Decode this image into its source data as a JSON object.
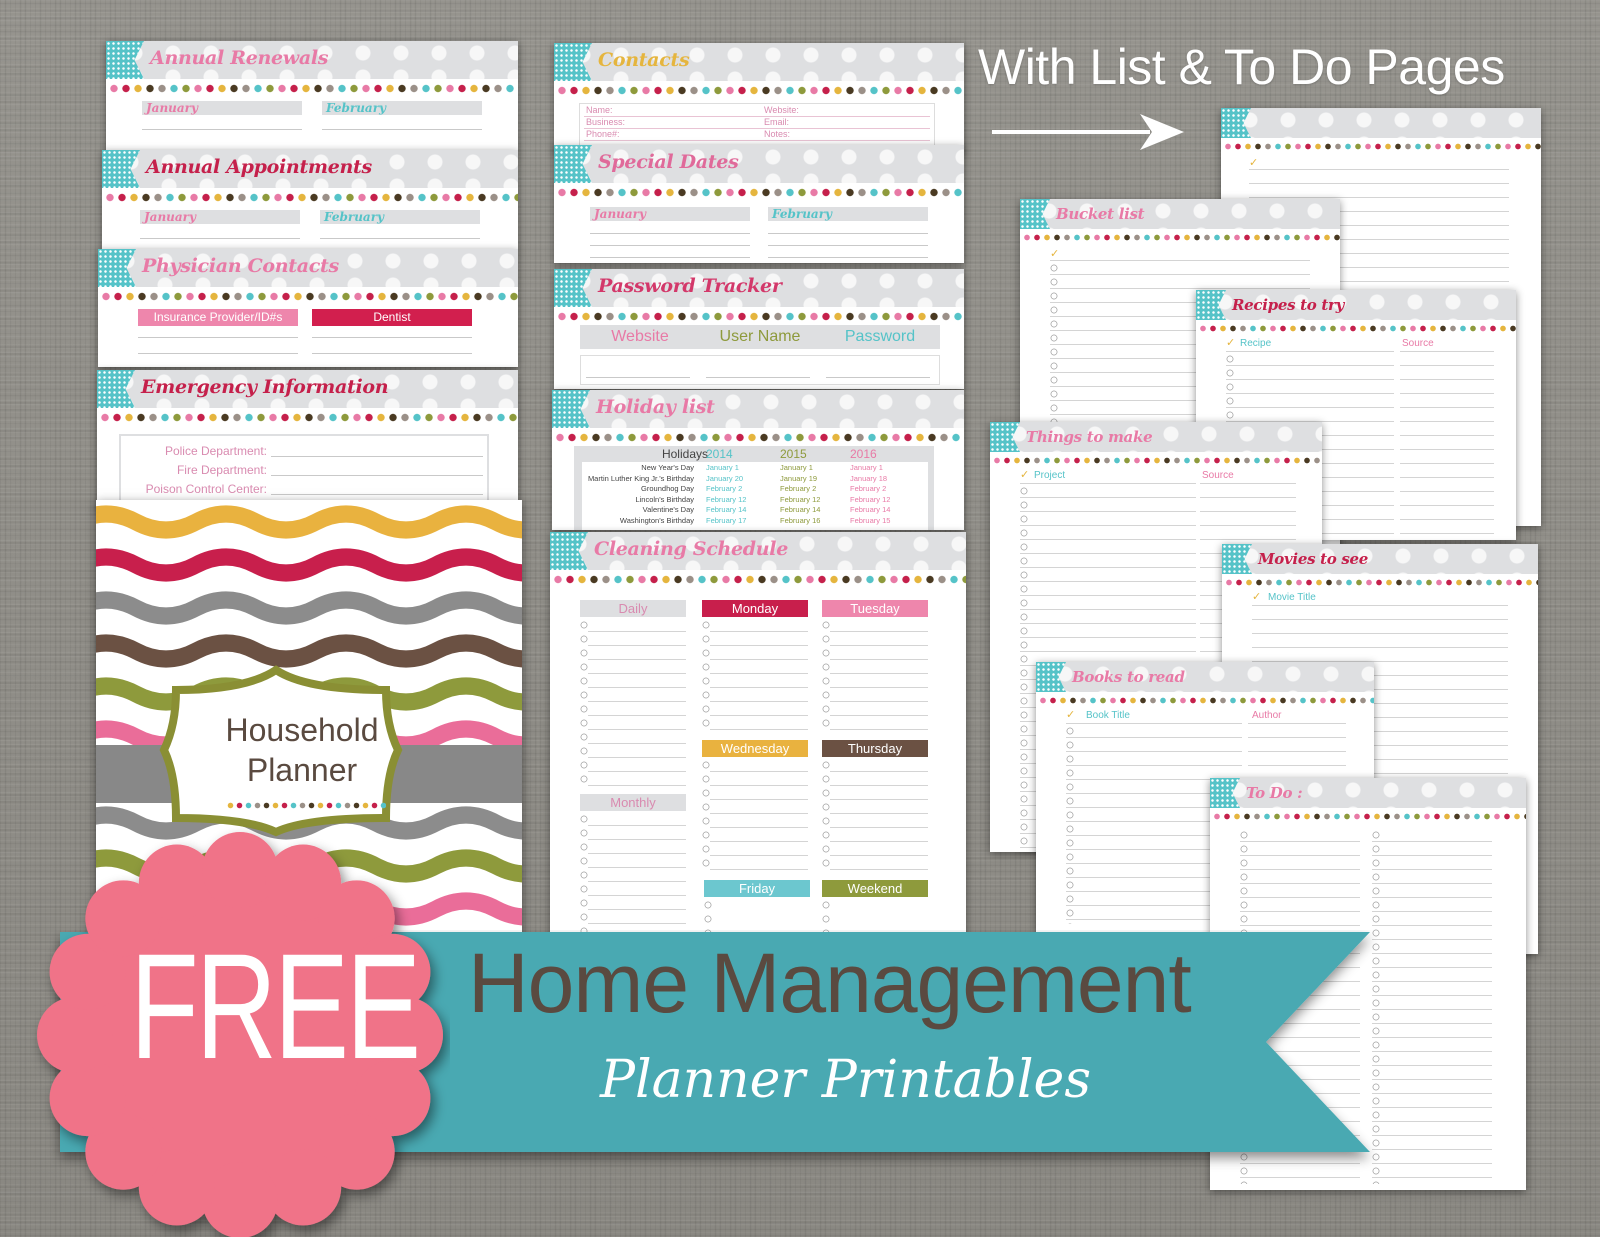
{
  "headline": {
    "top_caption": "With List & To Do Pages",
    "badge": "FREE",
    "banner_title": "Home Management",
    "banner_subtitle": "Planner Printables"
  },
  "colors": {
    "teal_banner": "#4aa9b2",
    "badge_pink": "#f07388",
    "pink": "#e87aa6",
    "red": "#c5204b",
    "gold": "#e5b53e",
    "brown": "#5a4636",
    "teal": "#55c3c8",
    "olive": "#8e9a3c",
    "gray_header": "#dedfe1",
    "background": "#8d8b85"
  },
  "cover": {
    "title_line1": "Household",
    "title_line2": "Planner"
  },
  "pages": {
    "annual_renewals": {
      "title": "Annual Renewals",
      "months": [
        "January",
        "February"
      ]
    },
    "annual_appointments": {
      "title": "Annual Appointments",
      "months": [
        "January",
        "February"
      ]
    },
    "physician_contacts": {
      "title": "Physician Contacts",
      "columns": [
        "Insurance Provider/ID#s",
        "Dentist"
      ]
    },
    "emergency_information": {
      "title": "Emergency Information",
      "fields": [
        "Police Department:",
        "Fire Department:",
        "Poison Control Center:"
      ]
    },
    "contacts": {
      "title": "Contacts",
      "left_fields": [
        "Name:",
        "Business:",
        "Phone#:"
      ],
      "right_fields": [
        "Website:",
        "Email:",
        "Notes:"
      ]
    },
    "special_dates": {
      "title": "Special Dates",
      "months": [
        "January",
        "February"
      ]
    },
    "password_tracker": {
      "title": "Password Tracker",
      "columns": [
        "Website",
        "User Name",
        "Password"
      ]
    },
    "holiday_list": {
      "title": "Holiday list",
      "header": "Holidays",
      "years": [
        "2014",
        "2015",
        "2016"
      ],
      "rows": [
        {
          "holiday": "New Year's Day",
          "dates": [
            "January 1",
            "January 1",
            "January 1"
          ]
        },
        {
          "holiday": "Martin Luther King Jr.'s Birthday",
          "dates": [
            "January 20",
            "January 19",
            "January 18"
          ]
        },
        {
          "holiday": "Groundhog Day",
          "dates": [
            "February 2",
            "February 2",
            "February 2"
          ]
        },
        {
          "holiday": "Lincoln's Birthday",
          "dates": [
            "February 12",
            "February 12",
            "February 12"
          ]
        },
        {
          "holiday": "Valentine's Day",
          "dates": [
            "February 14",
            "February 14",
            "February 14"
          ]
        },
        {
          "holiday": "Washington's Birthday",
          "dates": [
            "February 17",
            "February 16",
            "February 15"
          ]
        }
      ]
    },
    "cleaning_schedule": {
      "title": "Cleaning Schedule",
      "sections": [
        "Daily",
        "Monday",
        "Tuesday",
        "Wednesday",
        "Thursday",
        "Monthly",
        "Friday",
        "Weekend"
      ]
    },
    "todo_blank": {
      "title": "",
      "check": "✓"
    },
    "bucket_list": {
      "title": "Bucket list",
      "check": "✓"
    },
    "recipes_to_try": {
      "title": "Recipes to try",
      "check": "✓",
      "columns": [
        "Recipe",
        "Source"
      ]
    },
    "things_to_make": {
      "title": "Things to make",
      "check": "✓",
      "columns": [
        "Project",
        "Source"
      ]
    },
    "movies_to_see": {
      "title": "Movies to see",
      "check": "✓",
      "columns": [
        "Movie Title"
      ]
    },
    "books_to_read": {
      "title": "Books to read",
      "check": "✓",
      "columns": [
        "Book Title",
        "Author"
      ]
    },
    "to_do": {
      "title": "To Do :"
    }
  }
}
